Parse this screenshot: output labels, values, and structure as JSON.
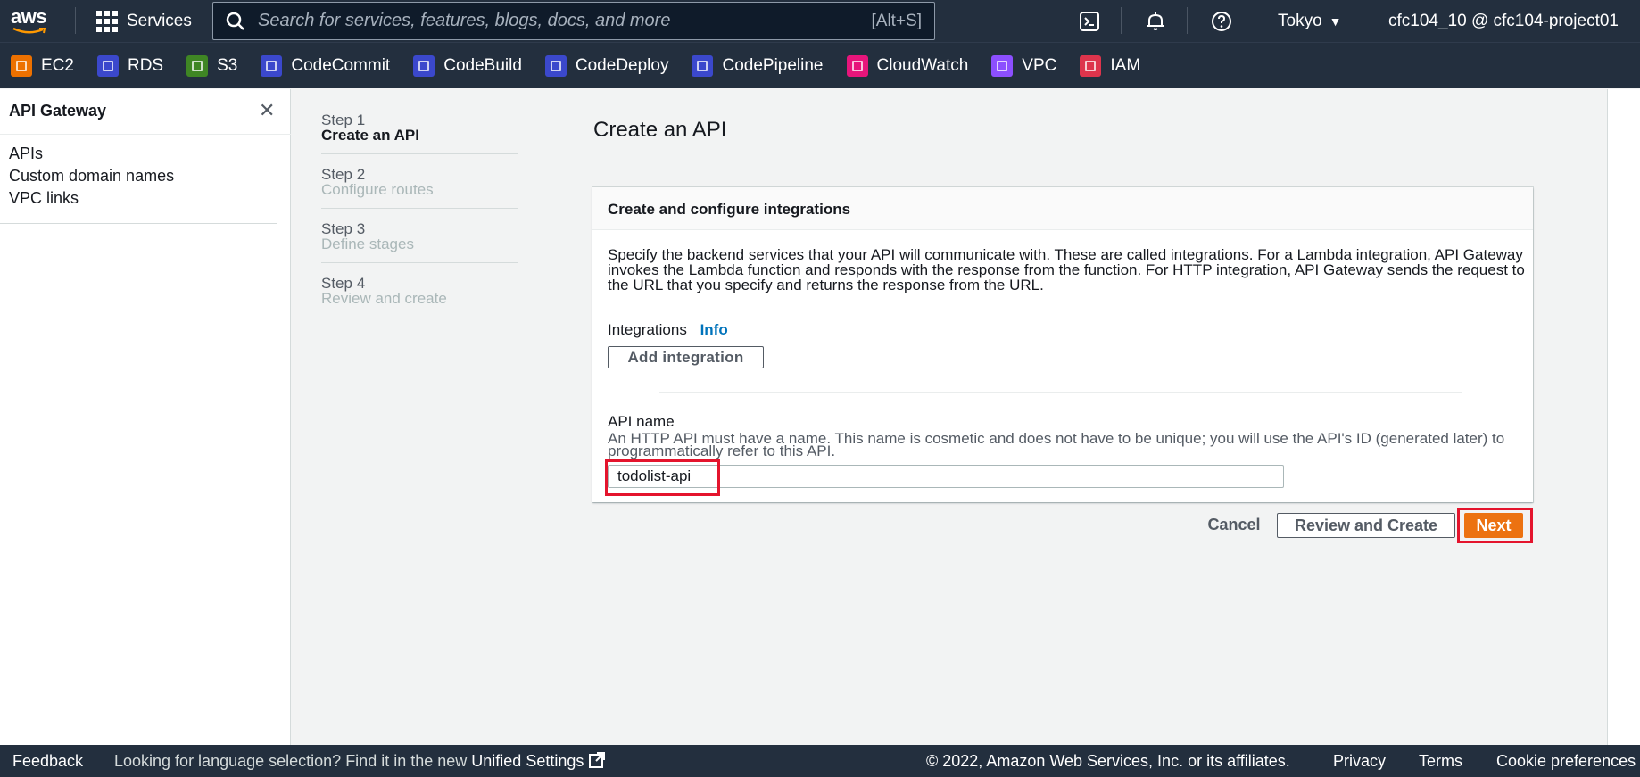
{
  "topnav": {
    "logo_text": "aws",
    "services_label": "Services",
    "search_placeholder": "Search for services, features, blogs, docs, and more",
    "search_shortcut": "[Alt+S]",
    "region": "Tokyo",
    "account": "cfc104_10 @ cfc104-project01"
  },
  "favorites": [
    {
      "label": "EC2",
      "color": "#ed7100"
    },
    {
      "label": "RDS",
      "color": "#3b48cc"
    },
    {
      "label": "S3",
      "color": "#3f8624"
    },
    {
      "label": "CodeCommit",
      "color": "#3b48cc"
    },
    {
      "label": "CodeBuild",
      "color": "#3b48cc"
    },
    {
      "label": "CodeDeploy",
      "color": "#3b48cc"
    },
    {
      "label": "CodePipeline",
      "color": "#3b48cc"
    },
    {
      "label": "CloudWatch",
      "color": "#e7157b"
    },
    {
      "label": "VPC",
      "color": "#8c4fff"
    },
    {
      "label": "IAM",
      "color": "#dd344c"
    }
  ],
  "sidebar": {
    "title": "API Gateway",
    "items": [
      "APIs",
      "Custom domain names",
      "VPC links"
    ]
  },
  "steps": [
    {
      "num": "Step 1",
      "name": "Create an API"
    },
    {
      "num": "Step 2",
      "name": "Configure routes"
    },
    {
      "num": "Step 3",
      "name": "Define stages"
    },
    {
      "num": "Step 4",
      "name": "Review and create"
    }
  ],
  "main": {
    "title": "Create an API",
    "panel": {
      "heading": "Create and configure integrations",
      "description": "Specify the backend services that your API will communicate with. These are called integrations. For a Lambda integration, API Gateway invokes the Lambda function and responds with the response from the function. For HTTP integration, API Gateway sends the request to the URL that you specify and returns the response from the URL.",
      "integrations_label": "Integrations",
      "info_label": "Info",
      "add_integration": "Add integration",
      "api_name_label": "API name",
      "api_name_desc": "An HTTP API must have a name. This name is cosmetic and does not have to be unique; you will use the API's ID (generated later) to programmatically refer to this API.",
      "api_name_value": "todolist-api"
    },
    "buttons": {
      "cancel": "Cancel",
      "review": "Review and Create",
      "next": "Next"
    }
  },
  "footer": {
    "feedback": "Feedback",
    "lang_text": "Looking for language selection? Find it in the new",
    "unified": "Unified Settings",
    "copyright": "© 2022, Amazon Web Services, Inc. or its affiliates.",
    "privacy": "Privacy",
    "terms": "Terms",
    "cookie": "Cookie preferences"
  },
  "colors": {
    "nav_bg": "#232f3e",
    "primary_button": "#ec7211",
    "highlight": "#e4142d",
    "link": "#0073bb"
  }
}
